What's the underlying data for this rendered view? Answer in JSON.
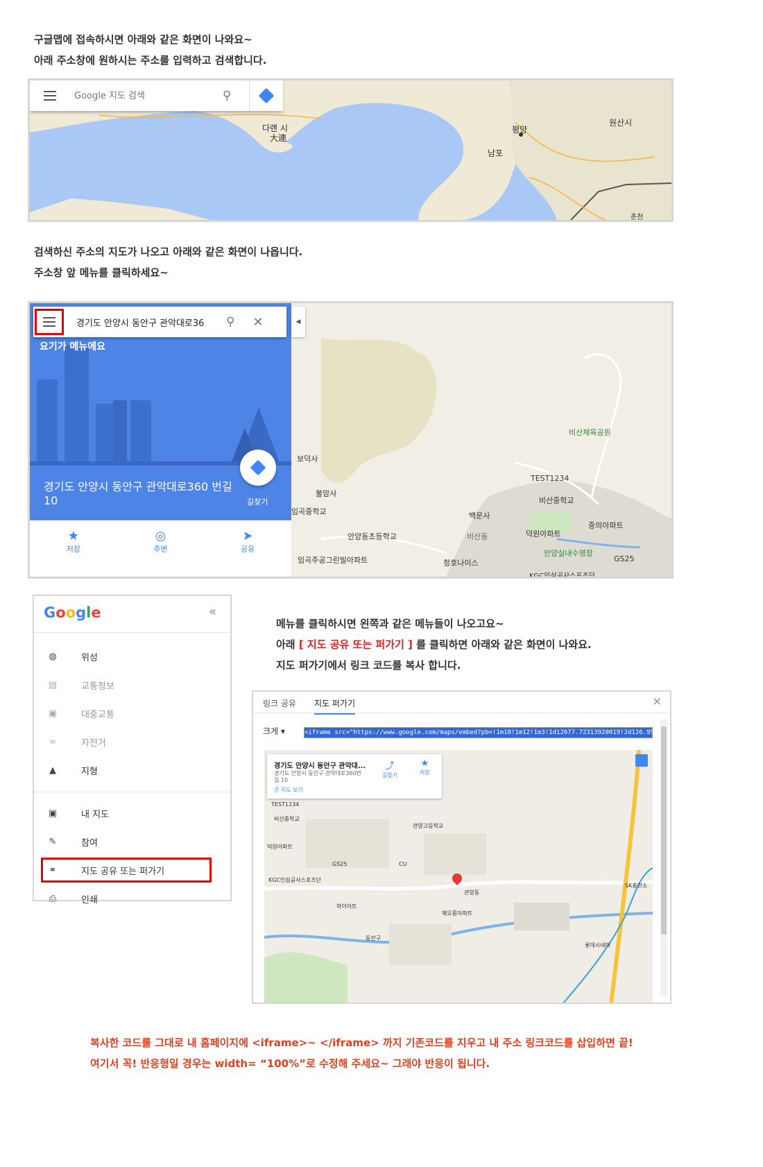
{
  "intro": {
    "line1": "구글맵에 접속하시면 아래와  같은 화면이 나와요~",
    "line2": "아래 주소창에 원하시는 주소를 입력하고 검색합니다."
  },
  "map1": {
    "search_placeholder": "Google 지도 검색",
    "labels": {
      "dalian_ko": "다롄 시",
      "dalian_zh": "大連",
      "pyongyang": "평양",
      "nampo": "남포",
      "wonsan": "원산시",
      "chuncheon": "춘천"
    }
  },
  "step2": {
    "line1": "검색하신 주소의 지도가 나오고 아래와 같은 화면이 나옵니다.",
    "line2": "주소창 앞 메뉴를 클릭하세요~"
  },
  "map2": {
    "search_value": "경기도 안양시 동안구 관악대로36",
    "menu_callout": "요기가 메뉴에요",
    "address": "경기도 안양시 동안구 관악대로360 번길 10",
    "directions_label": "길찾기",
    "actions": [
      {
        "label": "저장",
        "icon": "star-icon"
      },
      {
        "label": "주변",
        "icon": "nearby-icon"
      },
      {
        "label": "공유",
        "icon": "share-icon"
      }
    ],
    "labels": {
      "bisan_park": "비산체육공원",
      "test1234": "TEST1234",
      "bisan_middle": "비산중학교",
      "bodeoksa": "보덕사",
      "buramsa": "불암사",
      "imgok_middle": "임곡중학교",
      "anyangdong_elem": "안양동초등학교",
      "baekunsa": "백운사",
      "bisandong": "비산동",
      "deokwon_apt": "덕원아파트",
      "jungui_apt": "중의아파트",
      "anyang_pool": "안양실내수영장",
      "gs25": "GS25",
      "imgok_apt": "임곡주공그린빌아파트",
      "cheongho": "청호나이스",
      "kgc": "KGC인삼공사스포츠단"
    }
  },
  "side_menu": {
    "logo": "Google",
    "collapse": "«",
    "items": [
      {
        "label": "위성",
        "icon": "satellite-icon",
        "muted": false
      },
      {
        "label": "교통정보",
        "icon": "traffic-icon",
        "muted": true
      },
      {
        "label": "대중교통",
        "icon": "transit-icon",
        "muted": true
      },
      {
        "label": "자전거",
        "icon": "bicycle-icon",
        "muted": true
      },
      {
        "label": "지형",
        "icon": "terrain-icon",
        "muted": false
      }
    ],
    "items2": [
      {
        "label": "내 지도",
        "icon": "pin-icon"
      },
      {
        "label": "참여",
        "icon": "feedback-icon"
      },
      {
        "label": "지도 공유 또는 퍼가기",
        "icon": "link-icon"
      },
      {
        "label": "인쇄",
        "icon": "print-icon"
      }
    ]
  },
  "step3": {
    "line1": "메뉴를 클릭하시면 왼쪽과 같은 메뉴들이 나오고요~",
    "line2_a": "아래 ",
    "line2_b": "[ 지도 공유 또는 퍼가기 ]",
    "line2_c": " 를 클릭하면  아래와 같은 화면이 나와요.",
    "line3": "지도 퍼가기에서 링크 코드를 복사 합니다."
  },
  "embed_dialog": {
    "tab_share": "링크 공유",
    "tab_embed": "지도 퍼가기",
    "close": "×",
    "size_label": "크게",
    "code": "<iframe src=\"https://www.google.com/maps/embed?pb=!1m18!1m12!1m3!1d12677.72313920019!2d126.9541319416219",
    "card_title": "경기도 안양시 동안구 관악대...",
    "card_sub1": "경기도 안양시 동안구 관악대로360번",
    "card_sub2": "길 10",
    "card_link": "큰 지도 보기",
    "card_dir": "길찾기",
    "card_save": "저장",
    "labels": {
      "test": "TEST1234",
      "bisan": "비산중학교",
      "gwanyang": "관양고등학교",
      "deokwon": "덕원아파트",
      "gs25": "GS25",
      "kgc": "KGC인삼공사스포츠단",
      "gwanyangdong": "관양동",
      "cu": "CU",
      "hyomo": "해오름아파트",
      "sk": "SK충전소",
      "lotte": "롯데시네마",
      "dongangu": "동안구",
      "haram": "하이아트"
    }
  },
  "notes": {
    "line1": "복사한 코드를 그대로  내 홈페이지에 <iframe>~ </iframe> 까지 기존코드를 지우고  내 주소 링크코드를 삽입하면 끝!",
    "line2": "여기서 꼭! 반응형일 경우는 width= “100%”로 수정해 주세요~   그래야 반응이 됩니다."
  }
}
